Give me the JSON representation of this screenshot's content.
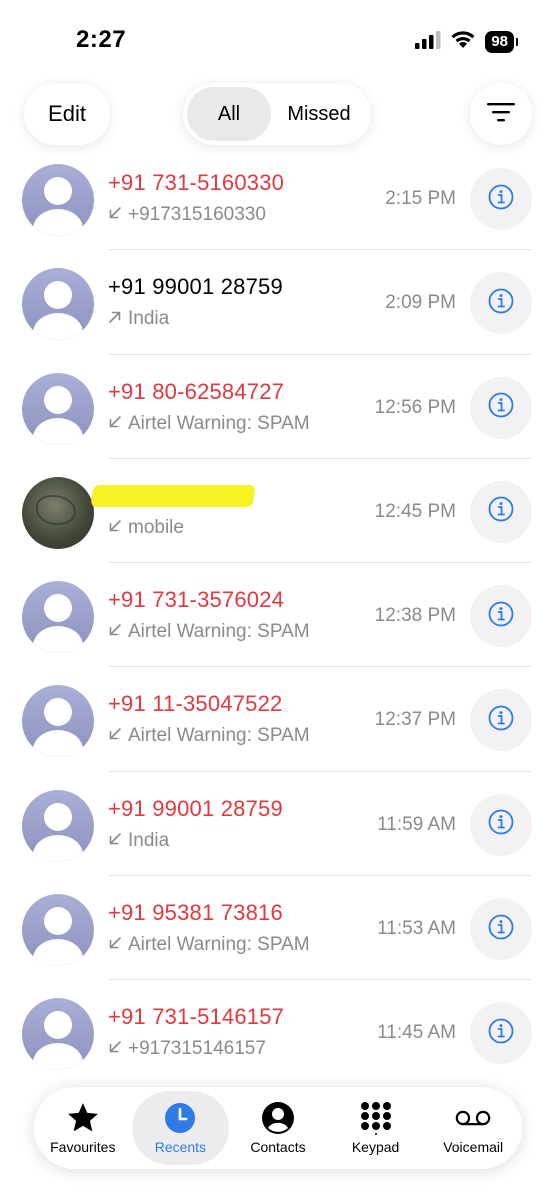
{
  "status_bar": {
    "time": "2:27",
    "battery": "98"
  },
  "toolbar": {
    "edit_label": "Edit",
    "filter_all": "All",
    "filter_missed": "Missed",
    "active_filter": "All"
  },
  "colors": {
    "missed": "#e0393e",
    "accent": "#2f7ae5",
    "secondary_text": "#8a8a8e"
  },
  "calls": [
    {
      "name": "+91 731-5160330",
      "detail": "+917315160330",
      "direction": "incoming",
      "missed": true,
      "time": "2:15 PM"
    },
    {
      "name": "+91 99001 28759",
      "detail": "India",
      "direction": "outgoing",
      "missed": false,
      "time": "2:09 PM"
    },
    {
      "name": "+91 80-62584727",
      "detail": "Airtel Warning: SPAM",
      "direction": "incoming",
      "missed": true,
      "time": "12:56 PM"
    },
    {
      "name": "",
      "detail": "mobile",
      "direction": "incoming",
      "missed": false,
      "time": "12:45 PM",
      "redacted": true
    },
    {
      "name": "+91 731-3576024",
      "detail": "Airtel Warning: SPAM",
      "direction": "incoming",
      "missed": true,
      "time": "12:38 PM"
    },
    {
      "name": "+91 11-35047522",
      "detail": "Airtel Warning: SPAM",
      "direction": "incoming",
      "missed": true,
      "time": "12:37 PM"
    },
    {
      "name": "+91 99001 28759",
      "detail": "India",
      "direction": "incoming",
      "missed": true,
      "time": "11:59 AM"
    },
    {
      "name": "+91 95381 73816",
      "detail": "Airtel Warning: SPAM",
      "direction": "incoming",
      "missed": true,
      "time": "11:53 AM"
    },
    {
      "name": "+91 731-5146157",
      "detail": "+917315146157",
      "direction": "incoming",
      "missed": true,
      "time": "11:45 AM"
    }
  ],
  "tab_bar": {
    "active": "Recents",
    "tabs": [
      {
        "label": "Favourites",
        "icon": "star-icon"
      },
      {
        "label": "Recents",
        "icon": "clock-icon"
      },
      {
        "label": "Contacts",
        "icon": "person-icon"
      },
      {
        "label": "Keypad",
        "icon": "keypad-icon"
      },
      {
        "label": "Voicemail",
        "icon": "voicemail-icon"
      }
    ]
  }
}
